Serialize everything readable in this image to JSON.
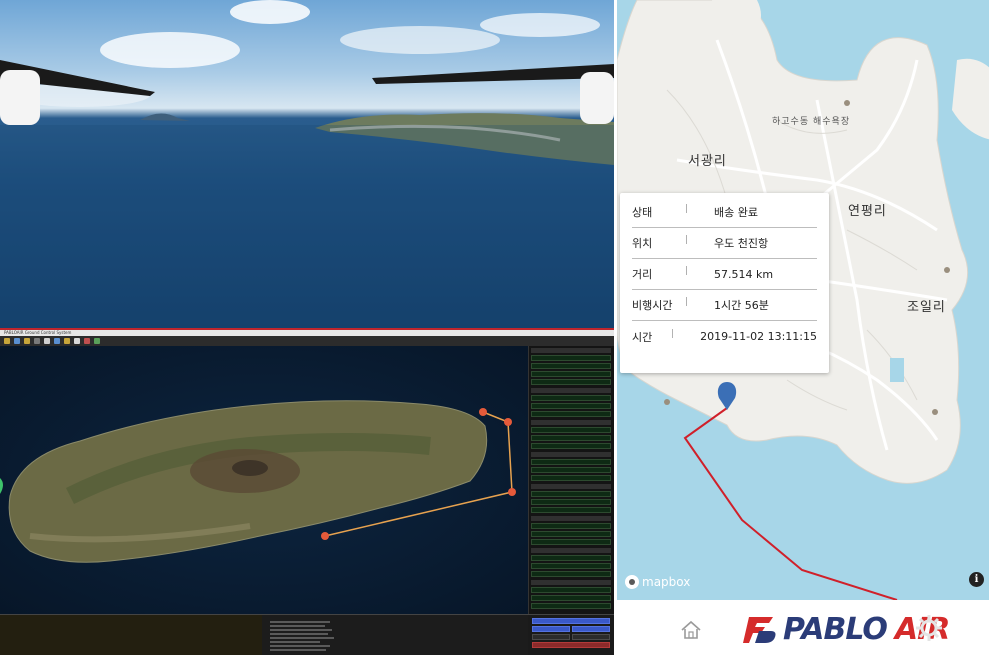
{
  "gcs": {
    "title": "PABLOAIR Ground Control System"
  },
  "delivery_info": {
    "rows": [
      {
        "key": "상태",
        "sep": "|",
        "value": "배송 완료"
      },
      {
        "key": "위치",
        "sep": "|",
        "value": "우도 천진항"
      },
      {
        "key": "거리",
        "sep": "|",
        "value": "57.514 km"
      },
      {
        "key": "비행시간",
        "sep": "|",
        "value": "1시간 56분"
      },
      {
        "key": "시간",
        "sep": "|",
        "value": "2019-11-02 13:11:15"
      }
    ]
  },
  "map_places": {
    "seogwang": "서광리",
    "hago_beach": "하고수동 해수욕장",
    "yeonpyeong": "연평리",
    "joil": "조일리"
  },
  "map_attribution": {
    "logo": "mapbox",
    "info": "i"
  },
  "footer": {
    "brand_pablo": "PABLO",
    "brand_air": "AIR",
    "home_icon": "home-icon",
    "gear_icon": "gear-icon"
  },
  "colors": {
    "route_red": "#d0202a",
    "brand_navy": "#2b3c78",
    "brand_red": "#d52b2b",
    "marker_blue": "#3b6fb6",
    "water": "#a7d6e8",
    "land": "#f0efeb"
  }
}
